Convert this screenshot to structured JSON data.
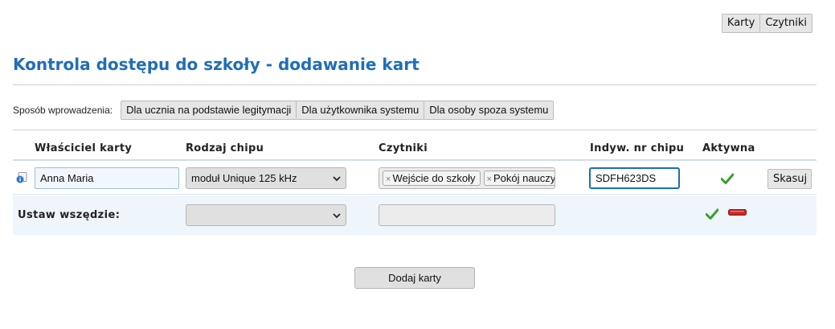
{
  "topnav": {
    "cards_label": "Karty",
    "readers_label": "Czytniki"
  },
  "page_title": "Kontrola dostępu do szkoły - dodawanie kart",
  "mode": {
    "label": "Sposób wprowadzenia:",
    "options": [
      "Dla ucznia na podstawie legitymacji",
      "Dla użytkownika systemu",
      "Dla osoby spoza systemu"
    ]
  },
  "table": {
    "headers": {
      "owner": "Właściciel karty",
      "chip_type": "Rodzaj chipu",
      "readers": "Czytniki",
      "chip_number": "Indyw. nr chipu",
      "active": "Aktywna"
    },
    "row": {
      "owner": "Anna Maria",
      "chip_type": "moduł Unique 125 kHz",
      "readers": [
        "Wejście do szkoły",
        "Pokój nauczycielski"
      ],
      "chip_number": "SDFH623DS",
      "active": true,
      "delete_label": "Skasuj"
    },
    "bulk": {
      "label": "Ustaw wszędzie:",
      "chip_type": "",
      "readers": ""
    }
  },
  "add_cards_label": "Dodaj karty",
  "colors": {
    "title": "#1f6eb8",
    "check": "#3aa02a",
    "minus": "#c62828",
    "info": "#2a78c4"
  }
}
